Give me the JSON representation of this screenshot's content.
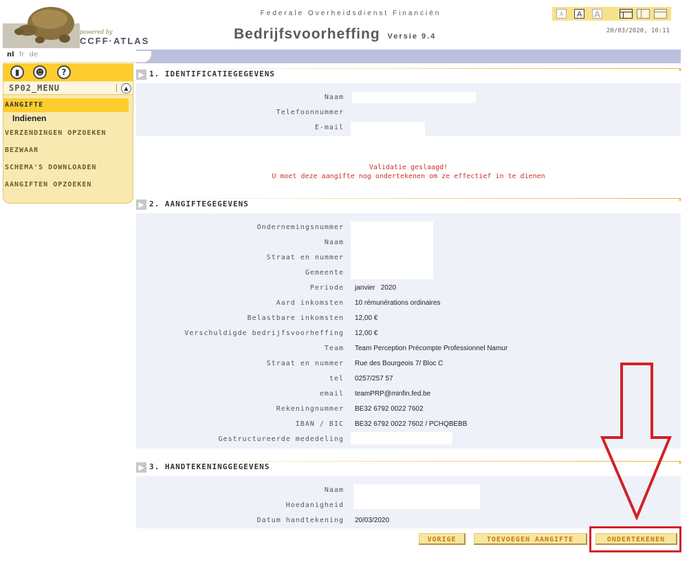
{
  "header": {
    "powered_by": "powered by",
    "brand": "CCFF·ATLAS",
    "organization": "Federale Overheidsdienst Financiën",
    "app_title": "Bedrijfsvoorheffing",
    "version": "Versie 9.4",
    "datetime": "20/03/2020, 10:11",
    "font_sizes": [
      "A",
      "A",
      "A"
    ]
  },
  "languages": [
    "nl",
    "fr",
    "de"
  ],
  "sidebar": {
    "menu_title": "SP02_MENU",
    "items": [
      {
        "label": "AANGIFTE",
        "active": true
      },
      {
        "label": "Indienen",
        "sub": true
      },
      {
        "label": "VERZENDINGEN OPZOEKEN"
      },
      {
        "label": "BEZWAAR"
      },
      {
        "label": "SCHEMA'S DOWNLOADEN"
      },
      {
        "label": "AANGIFTEN OPZOEKEN"
      }
    ]
  },
  "sections": {
    "identificatie": {
      "title": "1. IDENTIFICATIEGEGEVENS",
      "fields": [
        {
          "label": "Naam",
          "value": ""
        },
        {
          "label": "Telefoonnummer",
          "value": ""
        },
        {
          "label": "E-mail",
          "value": ""
        }
      ]
    },
    "aangifte": {
      "title": "2. AANGIFTEGEGEVENS",
      "fields": [
        {
          "label": "Ondernemingsnummer",
          "value": ""
        },
        {
          "label": "Naam",
          "value": ""
        },
        {
          "label": "Straat en nummer",
          "value": ""
        },
        {
          "label": "Gemeente",
          "value": ""
        },
        {
          "label": "Periode",
          "value": "janvier   2020"
        },
        {
          "label": "Aard inkomsten",
          "value": "10 rémunérations ordinaires"
        },
        {
          "label": "Belastbare inkomsten",
          "value": "12,00 €"
        },
        {
          "label": "Verschuldigde bedrijfsvoorheffing",
          "value": "12,00 €"
        },
        {
          "label": "Team",
          "value": "Team Perception Précompte Professionnel Namur"
        },
        {
          "label": "Straat en nummer",
          "value": "Rue des Bourgeois 7/ Bloc C"
        },
        {
          "label": "tel",
          "value": "0257/257 57"
        },
        {
          "label": "email",
          "value": "teamPRP@minfin.fed.be"
        },
        {
          "label": "Rekeningnummer",
          "value": "BE32 6792 0022 7602"
        },
        {
          "label": "IBAN / BIC",
          "value": "BE32 6792 0022 7602 / PCHQBEBB"
        },
        {
          "label": "Gestructureerde mededeling",
          "value": ""
        }
      ]
    },
    "handtekening": {
      "title": "3. HANDTEKENINGGEGEVENS",
      "fields": [
        {
          "label": "Naam",
          "value": ""
        },
        {
          "label": "Hoedanigheid",
          "value": ""
        },
        {
          "label": "Datum handtekening",
          "value": "20/03/2020"
        }
      ]
    }
  },
  "messages": {
    "validation": "Validatie geslaagd!",
    "sign_notice": "U moet deze aangifte nog ondertekenen om ze effectief in te dienen"
  },
  "buttons": {
    "previous": "VORIGE",
    "add": "TOEVOEGEN AANGIFTE",
    "sign": "ONDERTEKENEN"
  },
  "colors": {
    "accent_yellow": "#fccd2c",
    "panel_bg": "#eef1f8",
    "message_red": "#d03030",
    "highlight_red": "#d42028"
  }
}
